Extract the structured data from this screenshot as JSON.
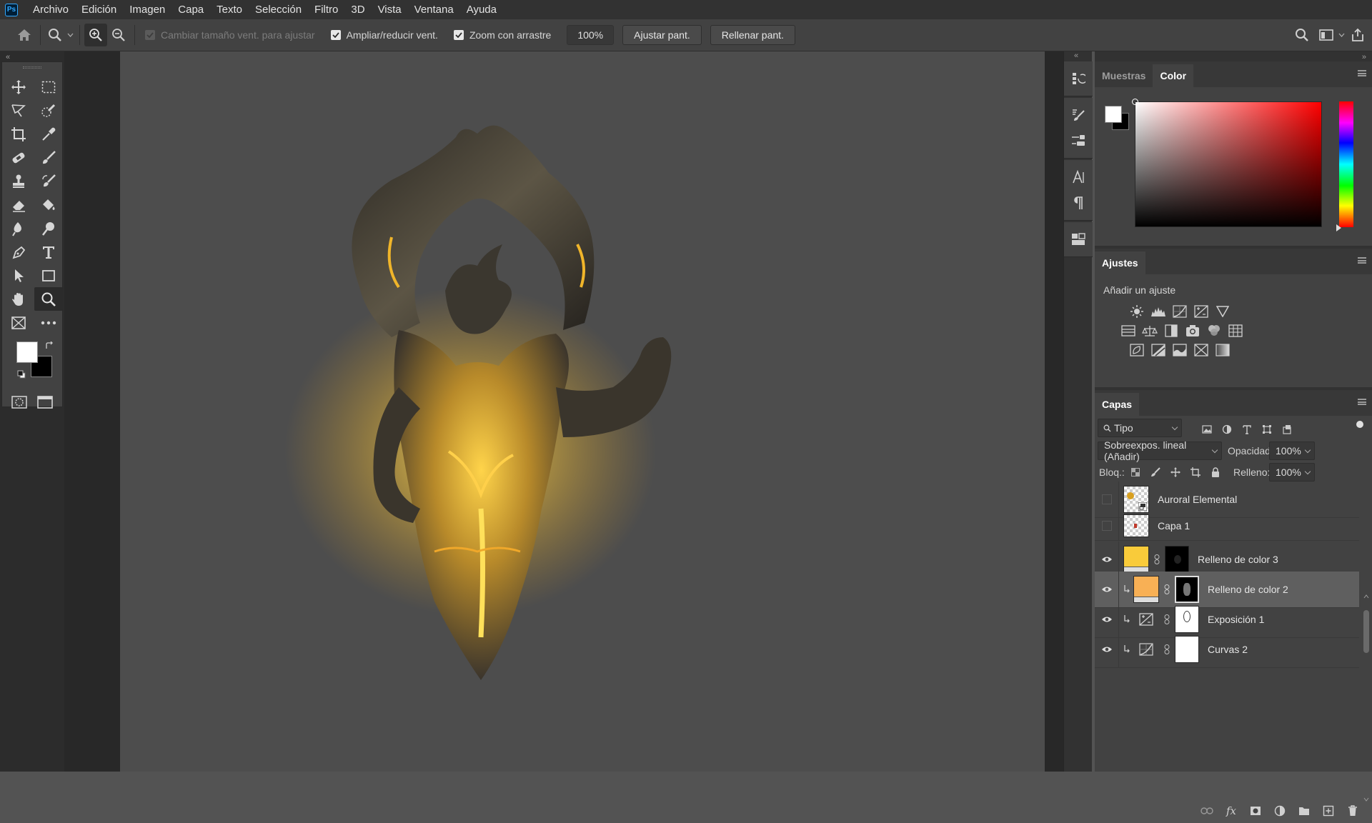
{
  "app": {
    "logo_text": "Ps"
  },
  "menu": [
    "Archivo",
    "Edición",
    "Imagen",
    "Capa",
    "Texto",
    "Selección",
    "Filtro",
    "3D",
    "Vista",
    "Ventana",
    "Ayuda"
  ],
  "options": {
    "resize_windows_label": "Cambiar tamaño vent. para ajustar",
    "resize_windows_checked": false,
    "zoom_all_label": "Ampliar/reducir vent.",
    "zoom_all_checked": true,
    "scrubby_zoom_label": "Zoom con arrastre",
    "scrubby_zoom_checked": true,
    "zoom_value": "100%",
    "fit_screen_label": "Ajustar pant.",
    "fill_screen_label": "Rellenar pant."
  },
  "tools": {
    "active": "zoom-tool",
    "foreground_color": "#ffffff",
    "background_color": "#000000"
  },
  "color_panel": {
    "tabs": [
      "Muestras",
      "Color"
    ],
    "active_tab": "Color",
    "hue_color": "#ff0000"
  },
  "adjustments_panel": {
    "title": "Ajustes",
    "subtitle": "Añadir un ajuste"
  },
  "layers_panel": {
    "title": "Capas",
    "filter_value": "Tipo",
    "blend_mode": "Sobreexpos. lineal (Añadir)",
    "opacity_label": "Opacidad:",
    "opacity_value": "100%",
    "lock_label": "Bloq.:",
    "fill_label": "Relleno:",
    "fill_value": "100%",
    "layers": [
      {
        "name": "Auroral Elemental",
        "visible": false,
        "clipped": false,
        "kind": "smart-object",
        "selected": false
      },
      {
        "name": "Capa 1",
        "visible": false,
        "clipped": false,
        "kind": "pixel",
        "selected": false
      },
      {
        "name": "Relleno de color 3",
        "visible": true,
        "clipped": false,
        "kind": "color-fill",
        "fill_color": "#f9cb3a",
        "selected": false
      },
      {
        "name": "Relleno de color 2",
        "visible": true,
        "clipped": true,
        "kind": "color-fill",
        "fill_color": "#f8b055",
        "selected": true
      },
      {
        "name": "Exposición 1",
        "visible": true,
        "clipped": true,
        "kind": "exposure",
        "selected": false
      },
      {
        "name": "Curvas 2",
        "visible": true,
        "clipped": true,
        "kind": "curves",
        "selected": false
      }
    ]
  }
}
